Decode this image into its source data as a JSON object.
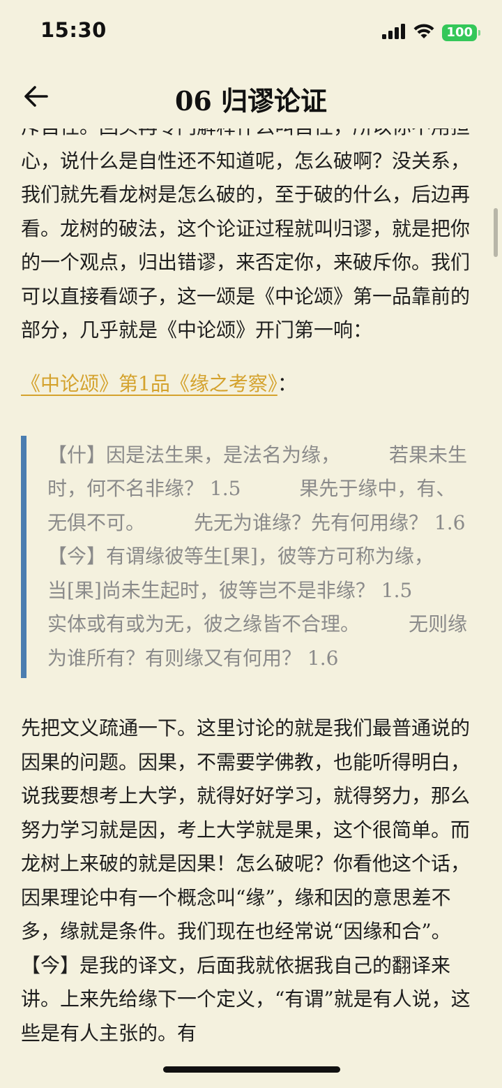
{
  "status_bar": {
    "time": "15:30",
    "battery": "100"
  },
  "header": {
    "title": "06 归谬论证"
  },
  "article": {
    "paragraph_1": "斥自性。回头再专门解释什么叫自性，所以你不用担心，说什么是自性还不知道呢，怎么破啊？没关系，我们就先看龙树是怎么破的，至于破的什么，后边再看。龙树的破法，这个论证过程就叫归谬，就是把你的一个观点，归出错谬，来否定你，来破斥你。我们可以直接看颂子，这一颂是《中论颂》第一品靠前的部分，几乎就是《中论颂》开门第一响：",
    "source_link": "《中论颂》第1品《缘之考察》",
    "source_colon": "：",
    "quote": "【什】因是法生果，是法名为缘，　　　若果未生时，何不名非缘？ 1.5　　　果先于缘中，有、无俱不可。　　　先无为谁缘？先有何用缘？ 1.6【今】有谓缘彼等生[果]，彼等方可称为缘，　　　当[果]尚未生起时，彼等岂不是非缘？ 1.5　　　实体或有或为无，彼之缘皆不合理。　　　无则缘为谁所有？有则缘又有何用？ 1.6",
    "paragraph_2": "先把文义疏通一下。这里讨论的就是我们最普通说的因果的问题。因果，不需要学佛教，也能听得明白，说我要想考上大学，就得好好学习，就得努力，那么努力学习就是因，考上大学就是果，这个很简单。而龙树上来破的就是因果！怎么破呢？你看他这个话，因果理论中有一个概念叫“缘”，缘和因的意思差不多，缘就是条件。我们现在也经常说“因缘和合”。【今】是我的译文，后面我就依据我自己的翻译来讲。上来先给缘下一个定义，“有谓”就是有人说，这些是有人主张的。有"
  },
  "colors": {
    "background": "#F4F1DE",
    "link": "#D4A22D",
    "quote_bar": "#4A7DB0",
    "quote_text": "#8a8a8a",
    "battery": "#34C759"
  }
}
